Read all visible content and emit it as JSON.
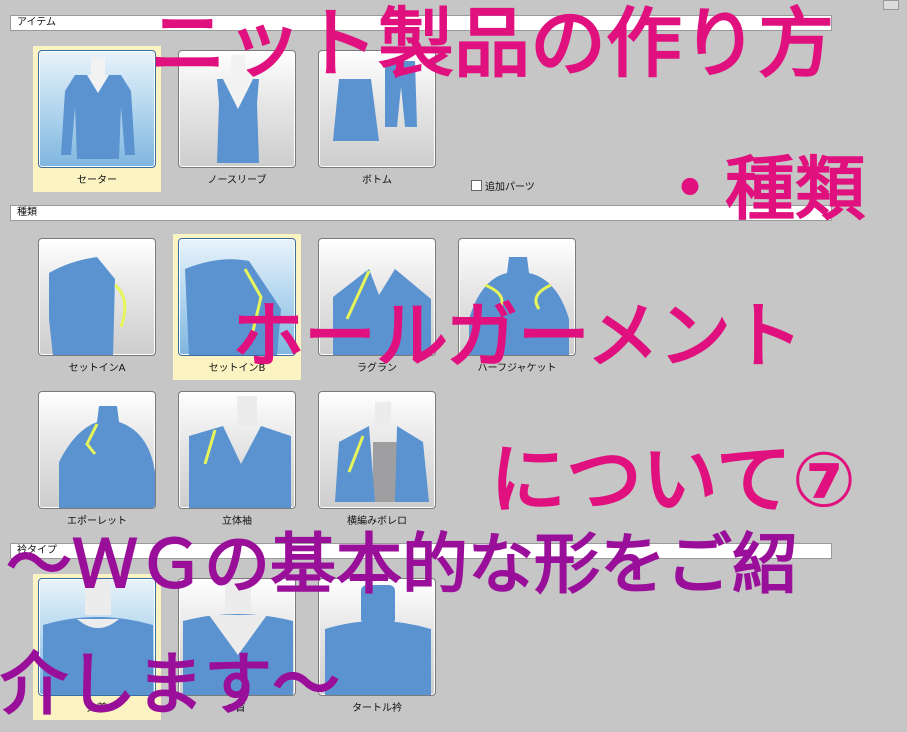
{
  "sections": {
    "item": "アイテム",
    "type": "種類",
    "collar": "衿タイプ"
  },
  "items": [
    {
      "label": "セーター",
      "selected": true,
      "icon": "sweater-icon"
    },
    {
      "label": "ノースリーブ",
      "selected": false,
      "icon": "sleeveless-icon"
    },
    {
      "label": "ボトム",
      "selected": false,
      "icon": "bottom-icon"
    }
  ],
  "add_parts": {
    "label": "追加パーツ",
    "checked": false
  },
  "types": [
    {
      "label": "セットインA",
      "selected": false
    },
    {
      "label": "セットインB",
      "selected": true
    },
    {
      "label": "ラグラン",
      "selected": false
    },
    {
      "label": "ハーフジャケット",
      "selected": false
    },
    {
      "label": "エポーレット",
      "selected": false
    },
    {
      "label": "立体袖",
      "selected": false
    },
    {
      "label": "横編みボレロ",
      "selected": false
    }
  ],
  "collars": [
    {
      "label": "丸首",
      "selected": true
    },
    {
      "label": "V首",
      "selected": false
    },
    {
      "label": "タートル衿",
      "selected": false
    }
  ],
  "overlay": {
    "line1": "ニット製品の作り方",
    "line2": "・種類",
    "line3": "ホールガーメント",
    "line4": "について⑦",
    "line5": "～ＷＧの基本的な形をご紹",
    "line6": "介します～"
  },
  "colors": {
    "accent_pink": "#e0117f",
    "accent_purple": "#9a0f9a",
    "selected_bg": "#fbf3c2",
    "garment_blue": "#5b93d1",
    "seam_yellow": "#e6f55a"
  }
}
